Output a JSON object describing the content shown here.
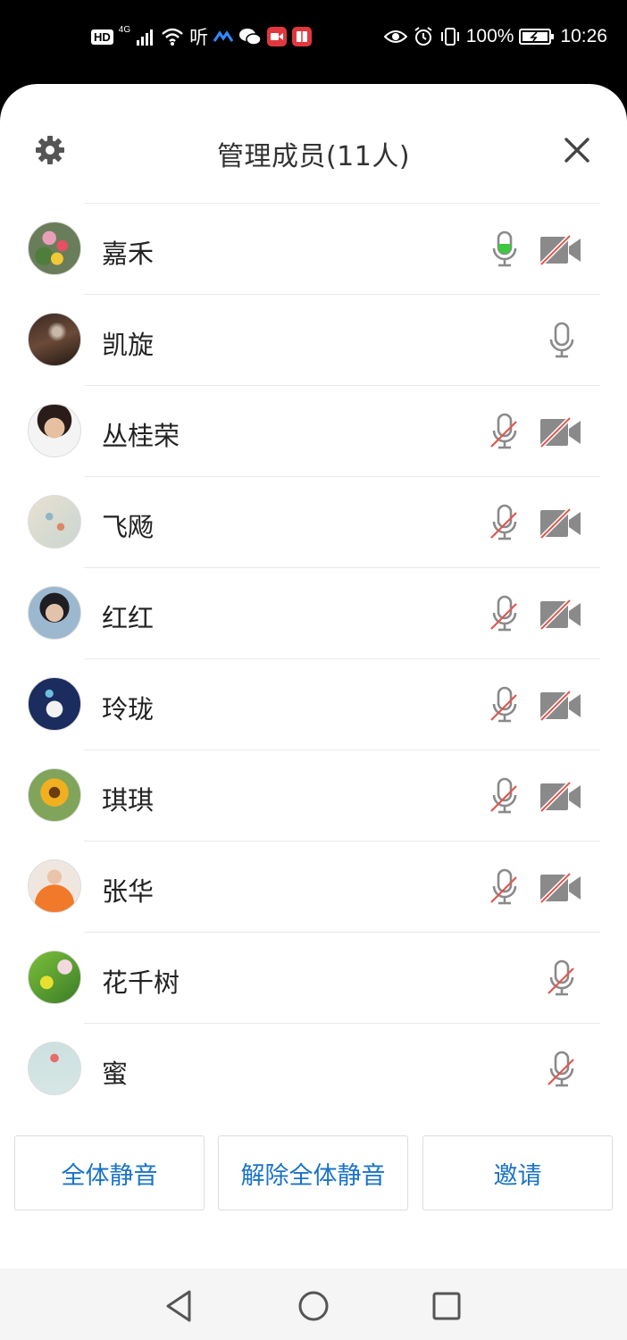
{
  "status_bar": {
    "hd": "HD",
    "network": "4G",
    "listen": "听",
    "battery": "100%",
    "time": "10:26"
  },
  "header": {
    "title": "管理成员(11人)",
    "settings_icon": "gear-icon",
    "close_icon": "close-icon"
  },
  "members": [
    {
      "name": "嘉禾",
      "mic": "active",
      "cam": "off"
    },
    {
      "name": "凯旋",
      "mic": "on",
      "cam": "none"
    },
    {
      "name": "丛桂荣",
      "mic": "muted",
      "cam": "off"
    },
    {
      "name": "飞飏",
      "mic": "muted",
      "cam": "off"
    },
    {
      "name": "红红",
      "mic": "muted",
      "cam": "off"
    },
    {
      "name": "玲珑",
      "mic": "muted",
      "cam": "off"
    },
    {
      "name": "琪琪",
      "mic": "muted",
      "cam": "off"
    },
    {
      "name": "张华",
      "mic": "muted",
      "cam": "off"
    },
    {
      "name": "花千树",
      "mic": "muted",
      "cam": "none"
    },
    {
      "name": "蜜",
      "mic": "muted",
      "cam": "none"
    }
  ],
  "actions": {
    "mute_all": "全体静音",
    "unmute_all": "解除全体静音",
    "invite": "邀请"
  },
  "colors": {
    "accent": "#1a73c8",
    "mic_active": "#3ec83e",
    "muted_slash": "#e0574f",
    "icon_gray": "#8a8a8a"
  }
}
